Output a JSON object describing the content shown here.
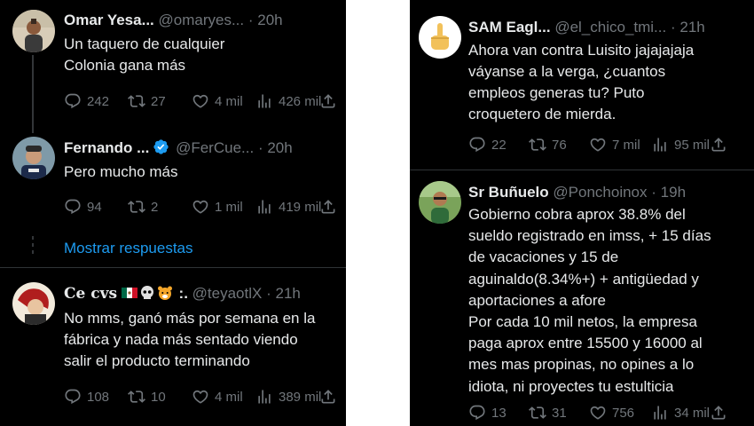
{
  "left": {
    "tweets": [
      {
        "name": "Omar Yesa...",
        "handle": "@omaryes...",
        "time": "20h",
        "lines": [
          "Un taquero de cualquier",
          "Colonia gana más"
        ],
        "replies": "242",
        "retweets": "27",
        "likes": "4 mil",
        "views": "426 mil"
      },
      {
        "name": "Fernando ...",
        "handle": "@FerCue...",
        "time": "20h",
        "lines": [
          "Pero mucho más"
        ],
        "replies": "94",
        "retweets": "2",
        "likes": "1 mil",
        "views": "419 mil"
      },
      {
        "name": "Ce cvs",
        "name_suffix": ":.",
        "handle": "@teyaotlX",
        "time": "21h",
        "lines": [
          "No mms, ganó más por semana en la",
          "fábrica y nada más sentado viendo",
          "salir el producto terminando"
        ],
        "replies": "108",
        "retweets": "10",
        "likes": "4 mil",
        "views": "389 mil"
      }
    ],
    "show_replies": "Mostrar respuestas"
  },
  "right": {
    "tweets": [
      {
        "name": "SAM Eagl...",
        "handle": "@el_chico_tmi...",
        "time": "21h",
        "lines": [
          "Ahora van contra Luisito jajajajaja",
          "váyanse a la verga, ¿cuantos",
          "empleos generas tu? Puto",
          "croquetero de mierda."
        ],
        "replies": "22",
        "retweets": "76",
        "likes": "7 mil",
        "views": "95 mil"
      },
      {
        "name": "Sr Buñuelo",
        "handle": "@Ponchoinox",
        "time": "19h",
        "lines": [
          "Gobierno cobra aprox 38.8% del",
          "sueldo registrado en imss, + 15 días",
          "de vacaciones y 15 de",
          "aguinaldo(8.34%+) + antigüedad y",
          "aportaciones a afore",
          "Por cada 10 mil netos, la empresa",
          "paga aprox entre 15500 y 16000 al",
          "mes mas propinas, no opines a lo",
          "idiota, ni proyectes tu estulticia"
        ],
        "replies": "13",
        "retweets": "31",
        "likes": "756",
        "views": "34 mil"
      }
    ]
  },
  "sep": "·",
  "colors": {
    "background": "#000000",
    "text": "#e7e9ea",
    "muted": "#71767b",
    "link": "#1d9bf0",
    "verified": "#1d9bf0"
  }
}
